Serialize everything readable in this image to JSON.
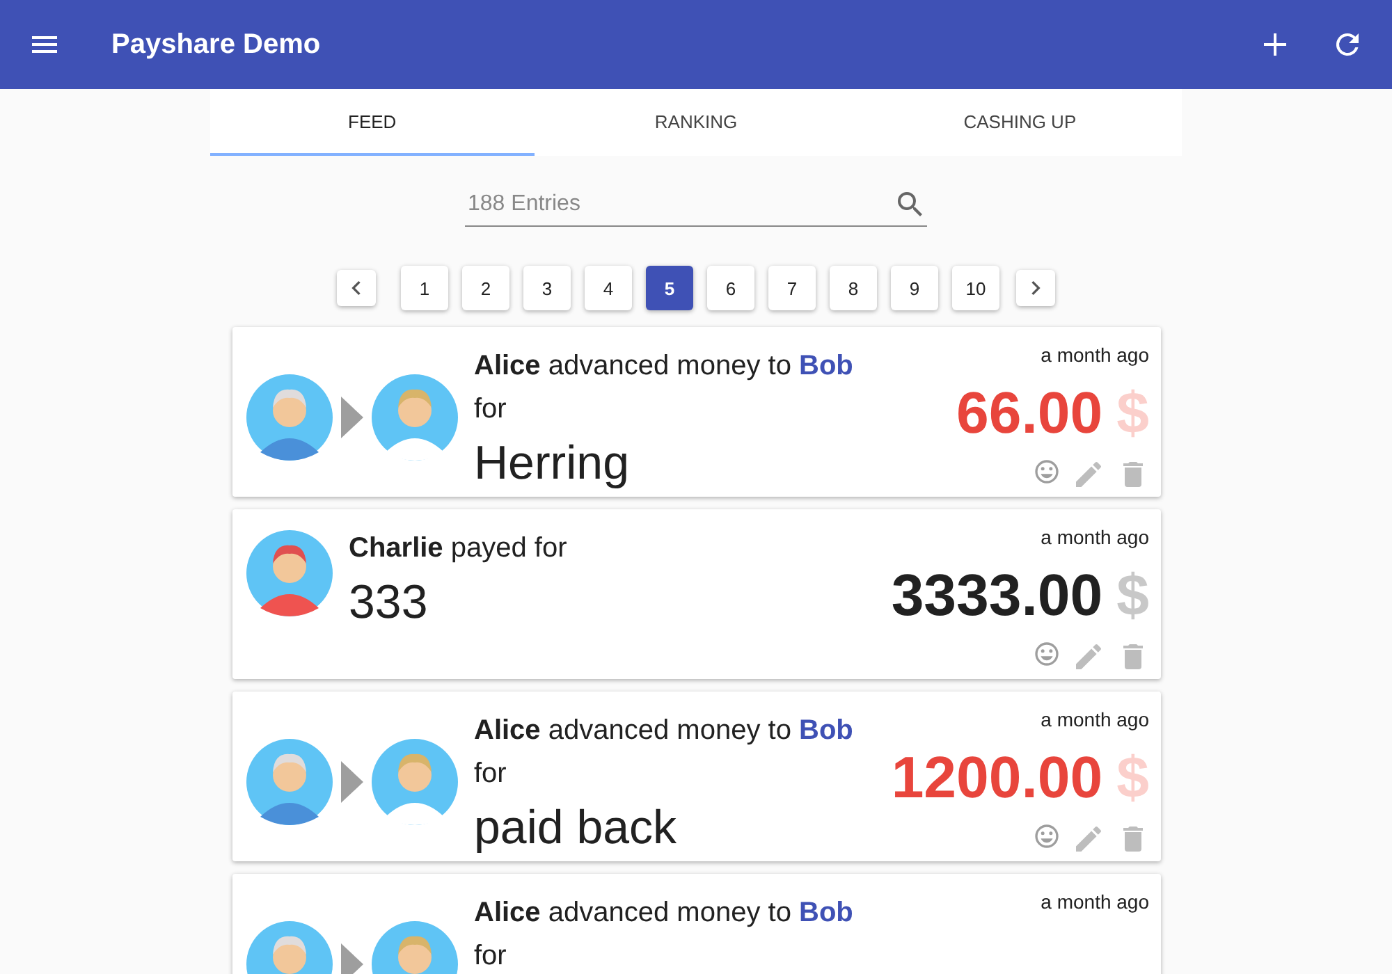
{
  "app_bar": {
    "title": "Payshare Demo"
  },
  "tabs": [
    {
      "label": "FEED",
      "selected": true
    },
    {
      "label": "RANKING",
      "selected": false
    },
    {
      "label": "CASHING UP",
      "selected": false
    }
  ],
  "search": {
    "placeholder": "188 Entries"
  },
  "pagination": {
    "pages": [
      {
        "label": "1",
        "selected": false
      },
      {
        "label": "2",
        "selected": false
      },
      {
        "label": "3",
        "selected": false
      },
      {
        "label": "4",
        "selected": false
      },
      {
        "label": "5",
        "selected": true
      },
      {
        "label": "6",
        "selected": false
      },
      {
        "label": "7",
        "selected": false
      },
      {
        "label": "8",
        "selected": false
      },
      {
        "label": "9",
        "selected": false
      },
      {
        "label": "10",
        "selected": false
      }
    ]
  },
  "entries": [
    {
      "kind": "advance",
      "payer": "Alice",
      "action": "advanced money to",
      "recipient": "Bob",
      "connector": "for",
      "description": "Herring",
      "time": "a month ago",
      "amount": "66.00",
      "currency": "$"
    },
    {
      "kind": "payment",
      "payer": "Charlie",
      "action": "payed for",
      "description": "333",
      "time": "a month ago",
      "amount": "3333.00",
      "currency": "$"
    },
    {
      "kind": "advance",
      "payer": "Alice",
      "action": "advanced money to",
      "recipient": "Bob",
      "connector": "for",
      "description": "paid back",
      "time": "a month ago",
      "amount": "1200.00",
      "currency": "$"
    },
    {
      "kind": "advance",
      "payer": "Alice",
      "action": "advanced money to",
      "recipient": "Bob",
      "connector": "for",
      "time": "a month ago"
    }
  ]
}
